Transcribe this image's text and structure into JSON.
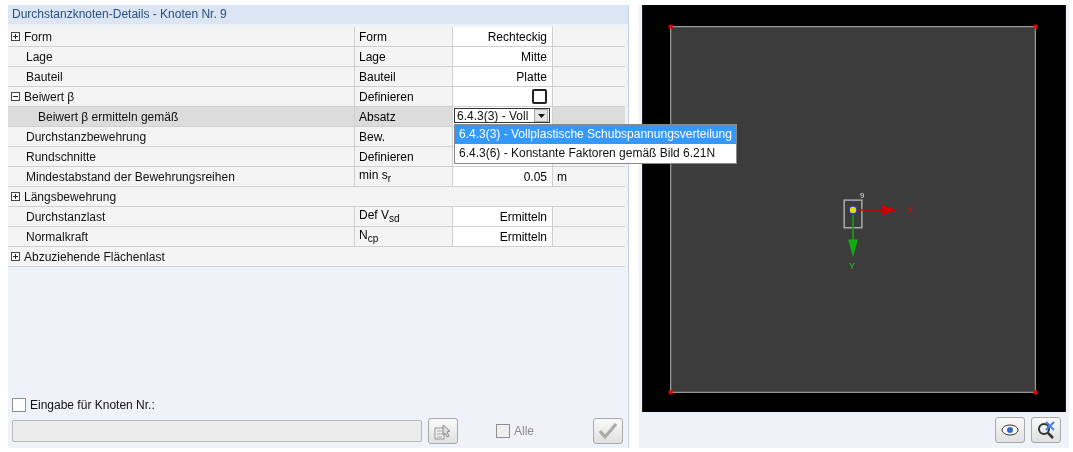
{
  "panel": {
    "title": "Durchstanzknoten-Details - Knoten Nr.  9"
  },
  "rows": [
    {
      "label": "Form",
      "expanded": false,
      "selected": false,
      "key": "Form",
      "value": {
        "kind": "text",
        "text": "Rechteckig"
      }
    },
    {
      "label": "Lage",
      "selected": false,
      "key": "Lage",
      "value": {
        "kind": "text",
        "text": "Mitte"
      }
    },
    {
      "label": "Bauteil",
      "selected": false,
      "key": "Bauteil",
      "value": {
        "kind": "text",
        "text": "Platte"
      }
    },
    {
      "label": "Beiwert β",
      "expanded": true,
      "selected": false,
      "key": "Definieren",
      "value": {
        "kind": "checkbox",
        "checked": false
      },
      "children": [
        {
          "label": "Beiwert β ermitteln gemäß",
          "selected": true,
          "key": "Absatz",
          "value": {
            "kind": "dropdown",
            "text": "6.4.3(3) - Voll",
            "open": true,
            "options": [
              {
                "label": "6.4.3(3) - Vollplastische Schubspannungsverteilung",
                "selected": true
              },
              {
                "label": "6.4.3(6) - Konstante Faktoren gemäß Bild 6.21N",
                "selected": false
              }
            ]
          }
        }
      ]
    },
    {
      "label": "Durchstanzbewehrung",
      "selected": false,
      "key": "Bew.",
      "value": {
        "kind": "empty"
      }
    },
    {
      "label": "Rundschnitte",
      "selected": false,
      "key": "Definieren",
      "value": {
        "kind": "empty"
      }
    },
    {
      "label": "Mindestabstand der Bewehrungsreihen",
      "selected": false,
      "key": "min s$_{r}$",
      "value": {
        "kind": "text",
        "text": "0.05"
      },
      "unit": "m"
    },
    {
      "label": "Längsbewehrung",
      "expanded": false,
      "selected": false
    },
    {
      "label": "Durchstanzlast",
      "selected": false,
      "key": "Def V$_{sd}$",
      "value": {
        "kind": "text",
        "text": "Ermitteln"
      }
    },
    {
      "label": "Normalkraft",
      "selected": false,
      "key": "N$_{cp}$",
      "value": {
        "kind": "text",
        "text": "Ermitteln"
      }
    },
    {
      "label": "Abzuziehende Flächenlast",
      "expanded": false,
      "selected": false
    }
  ],
  "node_input": {
    "label": "Eingabe für Knoten Nr.:",
    "checked": false,
    "all_label": "Alle",
    "all_checked": false,
    "disabled": true
  },
  "viewer": {
    "node_label": "9",
    "x_label": "X",
    "y_label": "Y"
  }
}
